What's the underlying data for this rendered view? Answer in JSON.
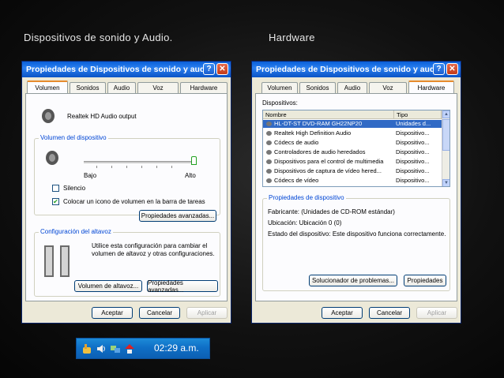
{
  "slide": {
    "left_title": "Dispositivos de sonido y Audio.",
    "right_title": "Hardware"
  },
  "left_window": {
    "title": "Propiedades de Dispositivos de sonido y audio",
    "tabs": [
      "Volumen",
      "Sonidos",
      "Audio",
      "Voz",
      "Hardware"
    ],
    "active_tab": "Volumen",
    "device_name": "Realtek HD Audio output",
    "device_volume_group": "Volumen del dispositivo",
    "slider_low": "Bajo",
    "slider_high": "Alto",
    "slider_level": 1.0,
    "mute_label": "Silencio",
    "mute_checked": false,
    "tray_icon_label": "Colocar un icono de volumen en la barra de tareas",
    "tray_icon_checked": true,
    "advanced_button": "Propiedades avanzadas...",
    "speaker_group": "Configuración del altavoz",
    "speaker_text_1": "Utilice esta configuración para cambiar el",
    "speaker_text_2": "volumen de altavoz y otras configuraciones.",
    "speaker_volume_button": "Volumen de altavoz...",
    "speaker_advanced_button": "Propiedades avanzadas...",
    "ok": "Aceptar",
    "cancel": "Cancelar",
    "apply": "Aplicar",
    "help": "?",
    "close": "✕"
  },
  "right_window": {
    "title": "Propiedades de Dispositivos de sonido y audio",
    "tabs": [
      "Volumen",
      "Sonidos",
      "Audio",
      "Voz",
      "Hardware"
    ],
    "active_tab": "Hardware",
    "devices_label": "Dispositivos:",
    "columns": [
      "Nombre",
      "Tipo"
    ],
    "rows": [
      {
        "name": "HL-DT-ST DVD-RAM GH22NP20",
        "type": "Unidades d..."
      },
      {
        "name": "Realtek High Definition Audio",
        "type": "Dispositivo..."
      },
      {
        "name": "Códecs de audio",
        "type": "Dispositivo..."
      },
      {
        "name": "Controladores de audio heredados",
        "type": "Dispositivo..."
      },
      {
        "name": "Dispositivos para el control de multimedia",
        "type": "Dispositivo..."
      },
      {
        "name": "Dispositivos de captura de vídeo hered...",
        "type": "Dispositivo..."
      },
      {
        "name": "Códecs de vídeo",
        "type": "Dispositivo..."
      }
    ],
    "selected_row": 0,
    "props_group": "Propiedades de dispositivo",
    "manufacturer": "Fabricante: (Unidades de CD-ROM estándar)",
    "location": "Ubicación: Ubicación 0 (0)",
    "status": "Estado del dispositivo: Este dispositivo funciona correctamente.",
    "troubleshoot_button": "Solucionador de problemas...",
    "properties_button": "Propiedades",
    "ok": "Aceptar",
    "cancel": "Cancelar",
    "apply": "Aplicar",
    "help": "?",
    "close": "✕"
  },
  "taskbar": {
    "clock": "02:29 a.m."
  },
  "colors": {
    "titlebar": "#0a5fd8",
    "selection": "#316ac5",
    "taskbar": "#0f6fc6"
  }
}
